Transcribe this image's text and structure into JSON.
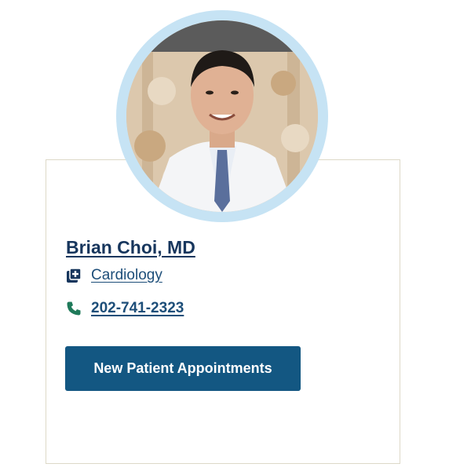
{
  "doctor": {
    "name": "Brian Choi, MD",
    "photo_icon": "doctor-portrait"
  },
  "specialty": {
    "label": "Cardiology",
    "icon": "medical-plus-icon"
  },
  "phone": {
    "number": "202-741-2323",
    "icon": "phone-icon"
  },
  "actions": {
    "appointment_label": "New Patient Appointments"
  },
  "colors": {
    "brand_navy": "#17365d",
    "link_blue": "#1d4e79",
    "button_bg": "#135782",
    "ring": "#c6e3f4",
    "phone_icon": "#1f7a5a"
  }
}
